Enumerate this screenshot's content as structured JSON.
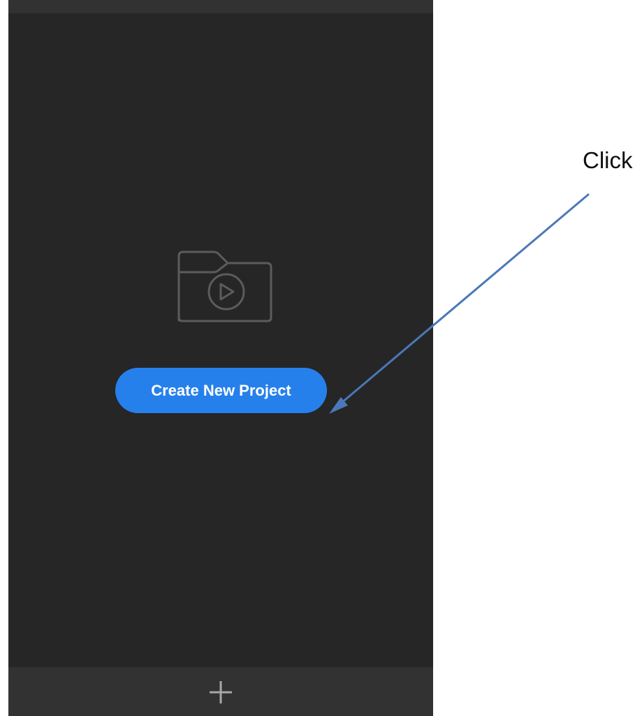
{
  "screen": {
    "empty_state": {
      "icon": "folder-play-icon",
      "create_button_label": "Create New Project"
    },
    "bottom_bar": {
      "add_icon": "plus-icon"
    }
  },
  "annotation": {
    "label": "Click",
    "arrow_icon": "arrow-icon",
    "arrow_color": "#4a78b8"
  },
  "colors": {
    "background": "#262626",
    "bar": "#323232",
    "accent": "#2680eb",
    "icon": "#5c5c5c"
  }
}
